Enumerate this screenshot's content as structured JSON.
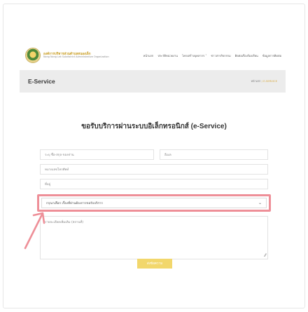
{
  "header": {
    "org_name_th": "องค์การบริหารส่วนตำบลหนองเล็ก",
    "org_name_en": "Nong Nong Lek Subdistrict Administrative Organization",
    "nav": [
      "หน้าแรก",
      "ประวัติหน่วยงาน",
      "โครงสร้างบุคลากร ˅",
      "ข่าวสารกิจกรรม",
      "ติดต่อเรื่องร้องเรียน",
      "ข้อมูลการติดต่อ"
    ]
  },
  "banner": {
    "title": "E-Service",
    "breadcrumb_home": "หน้าแรก",
    "breadcrumb_sep": "/",
    "breadcrumb_current": "E-SERVICE"
  },
  "form": {
    "heading": "ขอรับบริการผ่านระบบอิเล็กทรอนิกส์ (e-Service)",
    "name_placeholder": "ระบุ ชื่อ-สกุล ของท่าน",
    "email_placeholder": "อีเมล",
    "phone_placeholder": "หมายเลขโทรศัพท์",
    "address_placeholder": "ที่อยู่",
    "service_select": "กรุณาเลือก เรื่องที่ท่านต้องการขอรับบริการ",
    "details_placeholder": "รายละเอียดเพิ่มเติม (สถานที่)",
    "submit_label": "ส่งข้อความ"
  },
  "colors": {
    "accent": "#d8a93d",
    "button": "#f2d76c",
    "highlight": "#ee8f98"
  },
  "icons": {
    "select": "chevron-down-icon",
    "resize": "resize-handle-icon",
    "pointer": "pointer-arrow-icon"
  }
}
